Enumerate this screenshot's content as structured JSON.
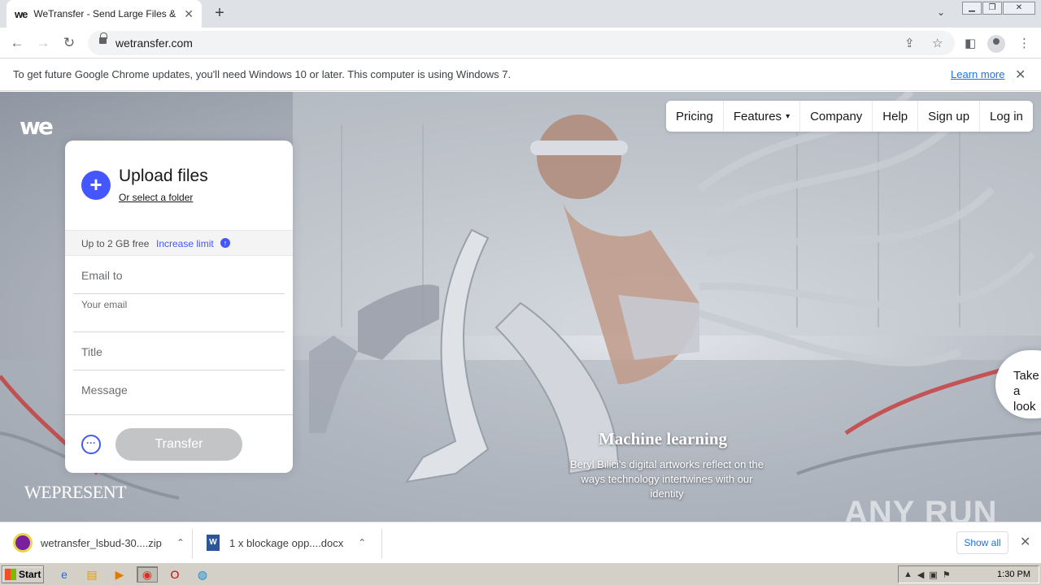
{
  "browser": {
    "tab": {
      "favicon": "we",
      "title": "WeTransfer - Send Large Files & Sha",
      "close_icon": "close-icon"
    },
    "new_tab": "+",
    "window_controls": [
      "minimize",
      "restore",
      "close"
    ],
    "url": "wetransfer.com"
  },
  "infobar": {
    "message": "To get future Google Chrome updates, you'll need Windows 10 or later. This computer is using Windows 7.",
    "link": "Learn more",
    "close": "✕"
  },
  "site": {
    "logo": "we",
    "nav": {
      "pricing": "Pricing",
      "features": "Features",
      "company": "Company",
      "help": "Help",
      "signup": "Sign up",
      "login": "Log in"
    },
    "upload_panel": {
      "title": "Upload files",
      "folder_link": "Or select a folder",
      "limit_text": "Up to 2 GB free",
      "limit_link": "Increase limit",
      "email_to": "Email to",
      "your_email": "Your email",
      "title_field": "Title",
      "message": "Message",
      "transfer_button": "Transfer"
    },
    "caption": {
      "title": "Machine learning",
      "text": "Beryl Bilici's digital artworks reflect on the ways technology intertwines with our identity"
    },
    "take_look": "Take a look",
    "wepresent": "WEPRESENT",
    "watermark": "ANY RUN",
    "brand_color": "#4457ff"
  },
  "downloads": {
    "items": [
      {
        "name": "wetransfer_lsbud-30....zip",
        "icon": "winrar-icon"
      },
      {
        "name": "1 x blockage opp....docx",
        "icon": "word-doc-icon"
      }
    ],
    "show_all": "Show all"
  },
  "taskbar": {
    "start": "Start",
    "clock": "1:30 PM"
  }
}
